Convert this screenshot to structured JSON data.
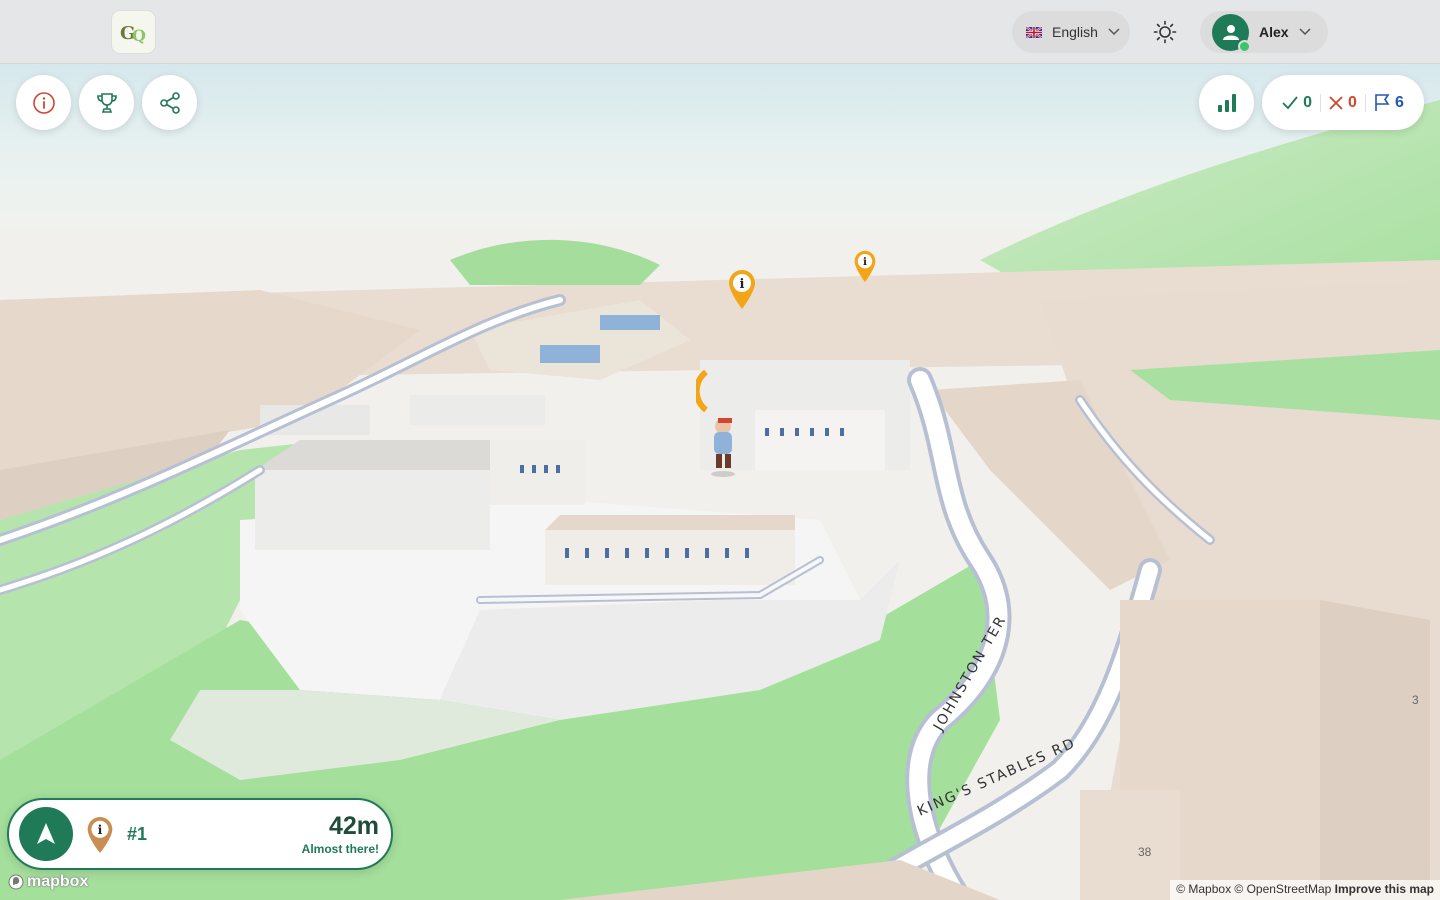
{
  "topbar": {
    "logo_text": "GQ",
    "language": {
      "label": "English",
      "flag": "uk-flag-icon"
    },
    "theme_icon": "sun-icon",
    "user": {
      "name": "Alex",
      "online": true
    }
  },
  "toolbar": {
    "buttons": [
      "info-icon",
      "trophy-icon",
      "share-icon"
    ]
  },
  "stats": {
    "leaderboard_icon": "bar-chart-icon",
    "correct": "0",
    "wrong": "0",
    "flags": "6",
    "colors": {
      "correct": "#1f7a58",
      "wrong": "#d2462d",
      "flags": "#2456b3"
    }
  },
  "map": {
    "streets": [
      "JOHNSTON TER",
      "KING'S STABLES RD"
    ],
    "house_numbers": [
      "38",
      "3"
    ],
    "markers": [
      "info-marker",
      "info-marker",
      "player-avatar"
    ]
  },
  "navigation": {
    "rank": "#1",
    "distance": "42m",
    "status": "Almost there!"
  },
  "attribution": {
    "mapbox_logo": "mapbox",
    "text": "© Mapbox © OpenStreetMap",
    "improve_link": "Improve this map"
  },
  "colors": {
    "brand": "#1f7a58",
    "marker": "#f2a516",
    "building": "#e8dcd0",
    "park": "#9fdc98"
  }
}
